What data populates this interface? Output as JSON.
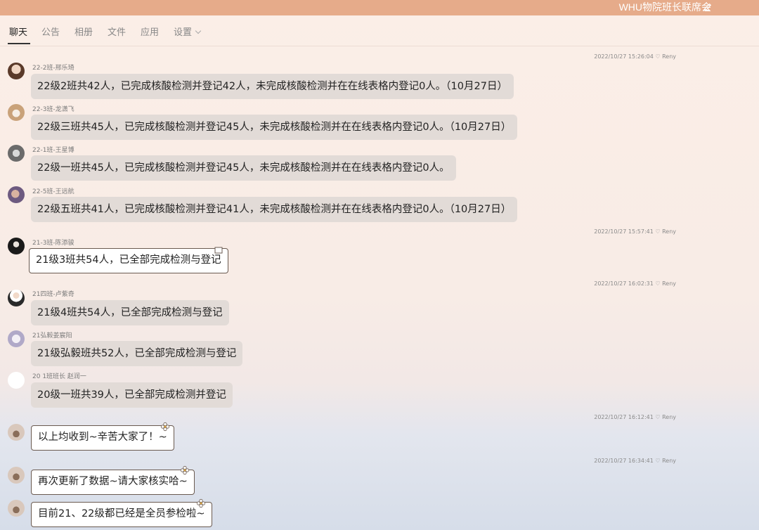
{
  "window": {
    "title": "WHU物院班长联席会"
  },
  "tabs": [
    {
      "label": "聊天",
      "active": true
    },
    {
      "label": "公告"
    },
    {
      "label": "相册"
    },
    {
      "label": "文件"
    },
    {
      "label": "应用"
    },
    {
      "label": "设置"
    }
  ],
  "timestamps": [
    "2022/10/27 15:26:04 ♡ Reny",
    "2022/10/27 15:57:41 ♡ Reny",
    "2022/10/27 16:02:31 ♡ Reny",
    "2022/10/27 16:12:41 ♡ Reny",
    "2022/10/27 16:34:41 ♡ Reny"
  ],
  "messages": [
    {
      "sender": "22-2班-邢乐琦",
      "text": "22级2班共42人，已完成核酸检测并登记42人，未完成核酸检测并在在线表格内登记0人。（10月27日）"
    },
    {
      "sender": "22-3班-龙潇飞",
      "text": "22级三班共45人，已完成核酸检测并登记45人，未完成核酸检测并在在线表格内登记0人。（10月27日）"
    },
    {
      "sender": "22-1班-王星博",
      "text": "22级一班共45人，已完成核酸检测并登记45人，未完成核酸检测并在在线表格内登记0人。"
    },
    {
      "sender": "22-5班-王远航",
      "text": "22级五班共41人，已完成核酸检测并登记41人，未完成核酸检测并在在线表格内登记0人。（10月27日）"
    },
    {
      "sender": "21-3班-陈添骏",
      "text": "21级3班共54人，已全部完成检测与登记"
    },
    {
      "sender": "21四班-卢紫奇",
      "text": "21级4班共54人，已全部完成检测与登记"
    },
    {
      "sender": "21弘毅姜宸阳",
      "text": "21级弘毅班共52人，已全部完成检测与登记"
    },
    {
      "sender": "20 1班班长 赵润一",
      "text": "20级一班共39人，已全部完成检测并登记"
    },
    {
      "sender": "",
      "text": "以上均收到~辛苦大家了！~"
    },
    {
      "sender": "",
      "text": "再次更新了数据~请大家核实哈~"
    },
    {
      "sender": "",
      "text": "目前21、22级都已经是全员参检啦~"
    }
  ],
  "colors": {
    "titlebar": "#e6ab8a",
    "bubble": "#e2dbd7",
    "deco_border": "#6a5a50"
  },
  "icons": {
    "edit": "pencil-icon",
    "settings_dropdown": "chevron-down-icon"
  }
}
